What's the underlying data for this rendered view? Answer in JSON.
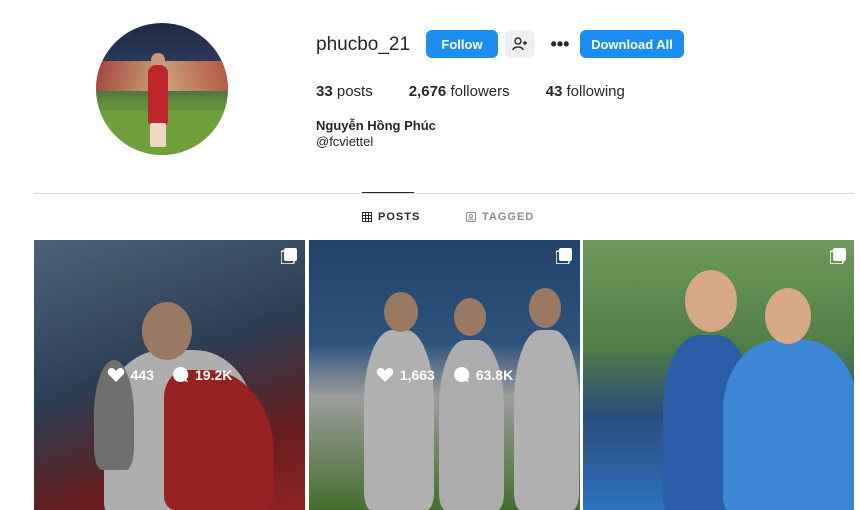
{
  "profile": {
    "username": "phucbo_21",
    "full_name": "Nguyễn Hồng Phúc",
    "handle": "@fcviettel",
    "actions": {
      "follow_label": "Follow",
      "more_label": "•••",
      "download_label": "Download All"
    },
    "stats": {
      "posts_count": "33",
      "posts_label": "posts",
      "followers_count": "2,676",
      "followers_label": "followers",
      "following_count": "43",
      "following_label": "following"
    }
  },
  "tabs": [
    {
      "label": "POSTS",
      "icon": "grid-icon",
      "active": true
    },
    {
      "label": "TAGGED",
      "icon": "tagged-icon",
      "active": false
    }
  ],
  "posts": [
    {
      "likes": "443",
      "comments": "19.2K"
    },
    {
      "likes": "1,663",
      "comments": "63.8K"
    },
    {
      "likes": "",
      "comments": ""
    }
  ],
  "colors": {
    "accent": "#1a8df0",
    "text": "#262626",
    "muted": "#8e8e8e",
    "divider": "#dbdbdb"
  }
}
